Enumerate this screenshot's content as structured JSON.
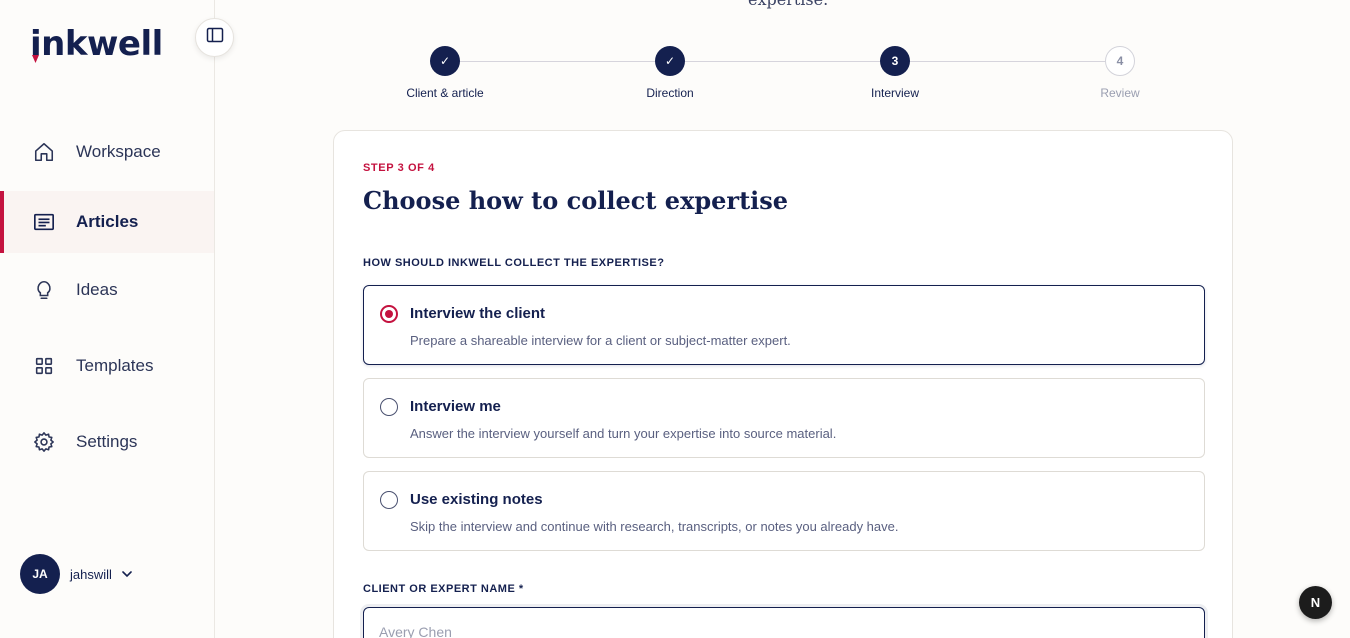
{
  "brand": {
    "name": "inkwell"
  },
  "sidebar": {
    "items": [
      {
        "label": "Workspace",
        "icon": "home-icon"
      },
      {
        "label": "Articles",
        "icon": "document-icon",
        "active": true
      },
      {
        "label": "Ideas",
        "icon": "lightbulb-icon"
      },
      {
        "label": "Templates",
        "icon": "grid-icon"
      },
      {
        "label": "Settings",
        "icon": "gear-icon"
      }
    ],
    "user": {
      "initials": "JA",
      "name": "jahswill"
    }
  },
  "page": {
    "cut_heading": "expertise."
  },
  "stepper": {
    "steps": [
      {
        "label": "Client & article",
        "state": "done",
        "marker": "✓"
      },
      {
        "label": "Direction",
        "state": "done",
        "marker": "✓"
      },
      {
        "label": "Interview",
        "state": "current",
        "marker": "3"
      },
      {
        "label": "Review",
        "state": "pending",
        "marker": "4"
      }
    ]
  },
  "card": {
    "eyebrow": "STEP 3 OF 4",
    "title": "Choose how to collect expertise",
    "question": "HOW SHOULD INKWELL COLLECT THE EXPERTISE?",
    "options": [
      {
        "title": "Interview the client",
        "desc": "Prepare a shareable interview for a client or subject-matter expert.",
        "selected": true
      },
      {
        "title": "Interview me",
        "desc": "Answer the interview yourself and turn your expertise into source material.",
        "selected": false
      },
      {
        "title": "Use existing notes",
        "desc": "Skip the interview and continue with research, transcripts, or notes you already have.",
        "selected": false
      }
    ],
    "name_label": "CLIENT OR EXPERT NAME *",
    "name_placeholder": "Avery Chen",
    "name_value": ""
  },
  "floating_badge": {
    "label": "N"
  },
  "colors": {
    "navy": "#14204f",
    "accent": "#c4123f",
    "background": "#fdfcfa"
  }
}
